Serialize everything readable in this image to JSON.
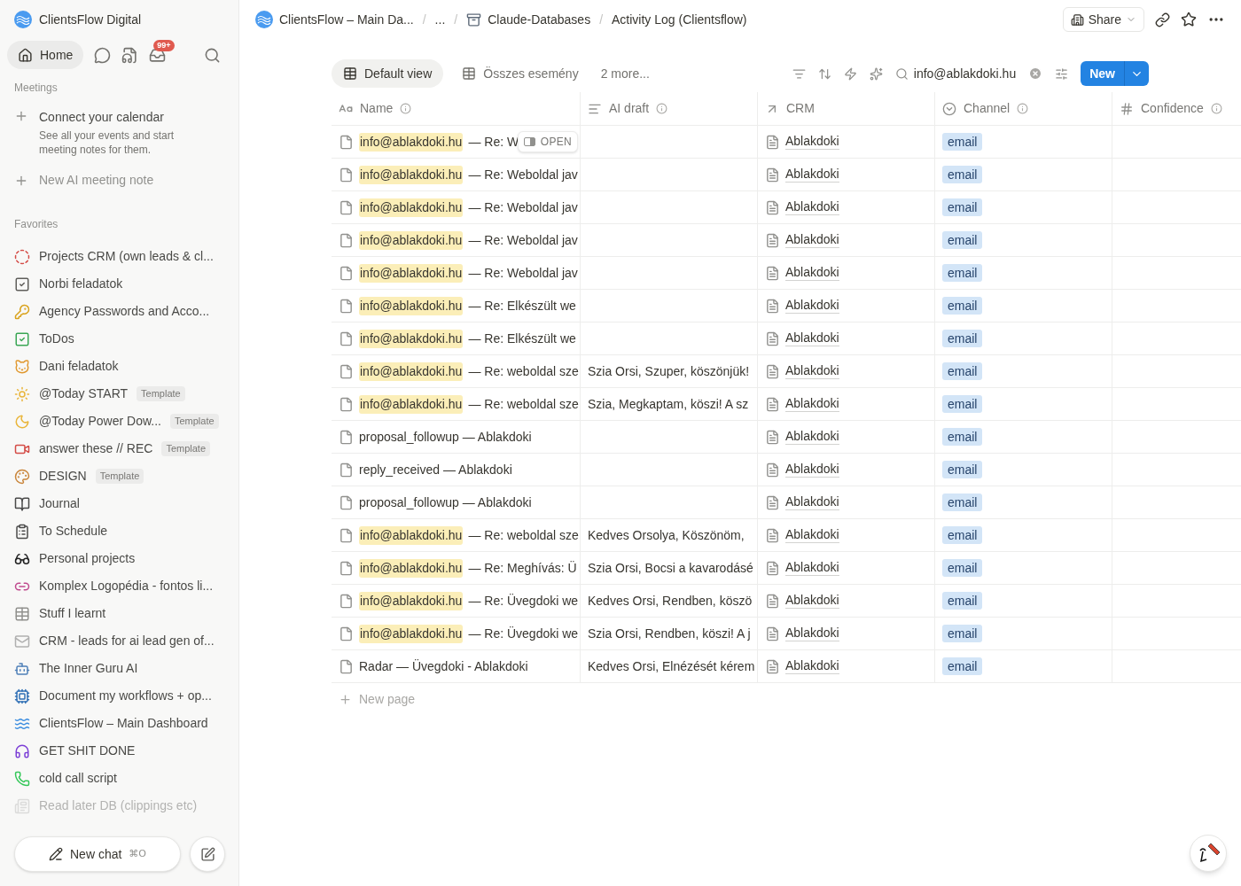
{
  "workspace": {
    "name": "ClientsFlow Digital"
  },
  "nav": {
    "home": "Home",
    "inbox_badge": "99+"
  },
  "meetings": {
    "heading": "Meetings",
    "connect_title": "Connect your calendar",
    "connect_text": "See all your events and start meeting notes for them.",
    "new_note": "New AI meeting note"
  },
  "favorites": {
    "heading": "Favorites",
    "items": [
      {
        "label": "Projects CRM (own leads & cl...",
        "faded": false
      },
      {
        "label": "Norbi feladatok",
        "faded": false
      },
      {
        "label": "Agency Passwords and Acco...",
        "faded": false
      },
      {
        "label": "ToDos",
        "faded": false
      },
      {
        "label": "Dani feladatok",
        "faded": false
      },
      {
        "label": "@Today START",
        "badge": "Template",
        "faded": false
      },
      {
        "label": "@Today Power Dow...",
        "badge": "Template",
        "faded": false
      },
      {
        "label": "answer these // REC",
        "badge": "Template",
        "faded": false
      },
      {
        "label": "DESIGN",
        "badge": "Template",
        "faded": false
      },
      {
        "label": "Journal",
        "faded": false
      },
      {
        "label": "To Schedule",
        "faded": false
      },
      {
        "label": "Personal projects",
        "faded": false
      },
      {
        "label": "Komplex Logopédia - fontos li...",
        "faded": false
      },
      {
        "label": "Stuff I learnt",
        "faded": false
      },
      {
        "label": "CRM - leads for ai lead gen of...",
        "faded": false
      },
      {
        "label": "The Inner Guru AI",
        "faded": false
      },
      {
        "label": "Document my workflows + op...",
        "faded": false
      },
      {
        "label": "ClientsFlow – Main Dashboard",
        "faded": false
      },
      {
        "label": "GET SHIT DONE",
        "faded": false
      },
      {
        "label": "cold call script",
        "faded": false
      },
      {
        "label": "Read later DB (clippings etc)",
        "faded": true
      }
    ]
  },
  "new_chat": {
    "label": "New chat",
    "shortcut": "⌘O"
  },
  "breadcrumbs": [
    {
      "text": "ClientsFlow – Main Da..."
    },
    {
      "sep": "/",
      "text": "..."
    },
    {
      "sep": "/",
      "text": "Claude-Databases"
    },
    {
      "sep": "/",
      "text": "Activity Log (Clientsflow)"
    }
  ],
  "header_actions": {
    "share": "Share"
  },
  "views": [
    {
      "label": "Default view",
      "selected": true
    },
    {
      "label": "Összes esemény",
      "selected": false
    }
  ],
  "more_views": "2 more...",
  "search_value": "info@ablakdoki.hu",
  "new_button": "New",
  "columns": [
    {
      "kind": "title",
      "label": "Name"
    },
    {
      "kind": "text",
      "label": "AI draft"
    },
    {
      "kind": "relation",
      "label": "CRM"
    },
    {
      "kind": "select",
      "label": "Channel"
    },
    {
      "kind": "number",
      "label": "Confidence"
    }
  ],
  "open_button": "OPEN",
  "rows": [
    {
      "highlight": "info@ablakdoki.hu",
      "title": "— Re: W",
      "crm": "Ablakdoki",
      "channel": "email"
    },
    {
      "highlight": "info@ablakdoki.hu",
      "title": "— Re: Weboldal jav",
      "crm": "Ablakdoki",
      "channel": "email"
    },
    {
      "highlight": "info@ablakdoki.hu",
      "title": "— Re: Weboldal jav",
      "crm": "Ablakdoki",
      "channel": "email"
    },
    {
      "highlight": "info@ablakdoki.hu",
      "title": "— Re: Weboldal jav",
      "crm": "Ablakdoki",
      "channel": "email"
    },
    {
      "highlight": "info@ablakdoki.hu",
      "title": "— Re: Weboldal jav",
      "crm": "Ablakdoki",
      "channel": "email"
    },
    {
      "highlight": "info@ablakdoki.hu",
      "title": "— Re: Elkészült we",
      "crm": "Ablakdoki",
      "channel": "email"
    },
    {
      "highlight": "info@ablakdoki.hu",
      "title": "— Re: Elkészült we",
      "crm": "Ablakdoki",
      "channel": "email"
    },
    {
      "highlight": "info@ablakdoki.hu",
      "title": "— Re: weboldal sze",
      "ai_draft": "Szia Orsi, Szuper, köszönjük!",
      "crm": "Ablakdoki",
      "channel": "email"
    },
    {
      "highlight": "info@ablakdoki.hu",
      "title": "— Re: weboldal sze",
      "ai_draft": "Szia, Megkaptam, köszi! A sz",
      "crm": "Ablakdoki",
      "channel": "email"
    },
    {
      "title": "proposal_followup — Ablakdoki",
      "crm": "Ablakdoki",
      "channel": "email"
    },
    {
      "title": "reply_received — Ablakdoki",
      "crm": "Ablakdoki",
      "channel": "email"
    },
    {
      "title": "proposal_followup — Ablakdoki",
      "crm": "Ablakdoki",
      "channel": "email"
    },
    {
      "highlight": "info@ablakdoki.hu",
      "title": "— Re: weboldal sze",
      "ai_draft": "Kedves Orsolya, Köszönöm,",
      "crm": "Ablakdoki",
      "channel": "email"
    },
    {
      "highlight": "info@ablakdoki.hu",
      "title": "— Re: Meghívás: Ü",
      "ai_draft": "Szia Orsi, Bocsi a kavarodásé",
      "crm": "Ablakdoki",
      "channel": "email"
    },
    {
      "highlight": "info@ablakdoki.hu",
      "title": "— Re: Üvegdoki we",
      "ai_draft": "Kedves Orsi, Rendben, köszö",
      "crm": "Ablakdoki",
      "channel": "email"
    },
    {
      "highlight": "info@ablakdoki.hu",
      "title": "— Re: Üvegdoki we",
      "ai_draft": "Szia Orsi, Rendben, köszi! A j",
      "crm": "Ablakdoki",
      "channel": "email"
    },
    {
      "title": "Radar — Üvegdoki - Ablakdoki",
      "ai_draft": "Kedves Orsi, Elnézését kérem",
      "crm": "Ablakdoki",
      "channel": "email"
    }
  ],
  "new_page": "New page"
}
